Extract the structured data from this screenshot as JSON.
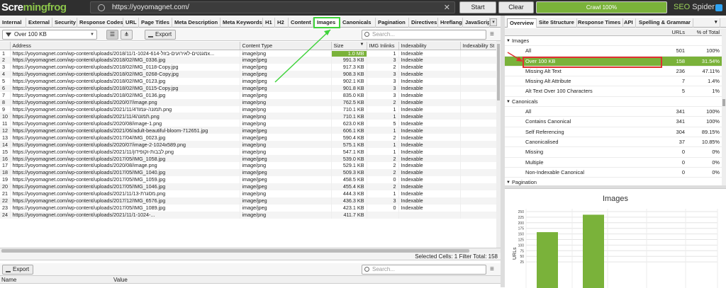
{
  "app": {
    "logo_main": "Scre",
    "logo_accent": "mingfrog",
    "url": "https://yoyomagnet.com/",
    "start_label": "Start",
    "clear_label": "Clear",
    "crawl_label": "Crawl 100%",
    "brand_seo": "SEO",
    "brand_spider": " Spider"
  },
  "tabs": [
    "Internal",
    "External",
    "Security",
    "Response Codes",
    "URL",
    "Page Titles",
    "Meta Description",
    "Meta Keywords",
    "H1",
    "H2",
    "Content",
    "Images",
    "Canonicals",
    "Pagination",
    "Directives",
    "Hreflang",
    "JavaScript"
  ],
  "toolbar": {
    "filter_value": "Over 100 KB",
    "export_label": "Export",
    "search_placeholder": "Search..."
  },
  "table": {
    "columns": [
      "",
      "Address",
      "Content Type",
      "Size",
      "IMG Inlinks",
      "Indexability",
      "Indexability St"
    ],
    "rows": [
      [
        "1",
        "https://yoyomagnet.com/wp-content/uploads/2018/11/1-1024-מגנטים-לאירועים-בזול-614x...",
        "image/png",
        "1.0 MB",
        "1",
        "Indexable"
      ],
      [
        "2",
        "https://yoyomagnet.com/wp-content/uploads/2018/02/IMG_0336.jpg",
        "image/jpeg",
        "991.3 KB",
        "3",
        "Indexable"
      ],
      [
        "3",
        "https://yoyomagnet.com/wp-content/uploads/2018/02/IMG_0118-Copy.jpg",
        "image/jpeg",
        "917.3 KB",
        "2",
        "Indexable"
      ],
      [
        "4",
        "https://yoyomagnet.com/wp-content/uploads/2018/02/IMG_0268-Copy.jpg",
        "image/jpeg",
        "908.3 KB",
        "3",
        "Indexable"
      ],
      [
        "5",
        "https://yoyomagnet.com/wp-content/uploads/2018/02/IMG_0123.jpg",
        "image/jpeg",
        "902.1 KB",
        "3",
        "Indexable"
      ],
      [
        "6",
        "https://yoyomagnet.com/wp-content/uploads/2018/02/IMG_0115-Copy.jpg",
        "image/jpeg",
        "901.8 KB",
        "3",
        "Indexable"
      ],
      [
        "7",
        "https://yoyomagnet.com/wp-content/uploads/2018/02/IMG_0136.jpg",
        "image/jpeg",
        "835.0 KB",
        "3",
        "Indexable"
      ],
      [
        "8",
        "https://yoyomagnet.com/wp-content/uploads/2020/07/image.png",
        "image/png",
        "762.5 KB",
        "2",
        "Indexable"
      ],
      [
        "9",
        "https://yoyomagnet.com/wp-content/uploads/2021/11/תמונה-עמוד4.png",
        "image/png",
        "710.1 KB",
        "1",
        "Indexable"
      ],
      [
        "10",
        "https://yoyomagnet.com/wp-content/uploads/2021/11/תמונה4.png",
        "image/png",
        "710.1 KB",
        "1",
        "Indexable"
      ],
      [
        "11",
        "https://yoyomagnet.com/wp-content/uploads/2020/08/image-1.png",
        "image/png",
        "623.0 KB",
        "5",
        "Indexable"
      ],
      [
        "12",
        "https://yoyomagnet.com/wp-content/uploads/2021/06/adult-beautiful-bloom-712651.jpg",
        "image/jpeg",
        "606.1 KB",
        "1",
        "Indexable"
      ],
      [
        "13",
        "https://yoyomagnet.com/wp-content/uploads/2017/04/IMG_0023.jpg",
        "image/jpeg",
        "590.4 KB",
        "2",
        "Indexable"
      ],
      [
        "14",
        "https://yoyomagnet.com/wp-content/uploads/2020/07/image-2-1024x589.png",
        "image/png",
        "575.1 KB",
        "1",
        "Indexable"
      ],
      [
        "15",
        "https://yoyomagnet.com/wp-content/uploads/2021/11/לבבות-וקופידון.png",
        "image/png",
        "547.1 KB",
        "1",
        "Indexable"
      ],
      [
        "16",
        "https://yoyomagnet.com/wp-content/uploads/2017/05/IMG_1058.jpg",
        "image/jpeg",
        "539.0 KB",
        "2",
        "Indexable"
      ],
      [
        "17",
        "https://yoyomagnet.com/wp-content/uploads/2020/08/image.png",
        "image/png",
        "529.1 KB",
        "2",
        "Indexable"
      ],
      [
        "18",
        "https://yoyomagnet.com/wp-content/uploads/2017/05/IMG_1040.jpg",
        "image/jpeg",
        "509.3 KB",
        "2",
        "Indexable"
      ],
      [
        "19",
        "https://yoyomagnet.com/wp-content/uploads/2017/05/IMG_1059.jpg",
        "image/jpeg",
        "458.5 KB",
        "0",
        "Indexable"
      ],
      [
        "20",
        "https://yoyomagnet.com/wp-content/uploads/2017/05/IMG_1046.jpg",
        "image/jpeg",
        "455.4 KB",
        "2",
        "Indexable"
      ],
      [
        "21",
        "https://yoyomagnet.com/wp-content/uploads/2021/11/13-מסגרת.png",
        "image/png",
        "444.3 KB",
        "1",
        "Indexable"
      ],
      [
        "22",
        "https://yoyomagnet.com/wp-content/uploads/2017/12/IMG_6576.jpg",
        "image/jpeg",
        "436.3 KB",
        "3",
        "Indexable"
      ],
      [
        "23",
        "https://yoyomagnet.com/wp-content/uploads/2017/05/IMG_1089.jpg",
        "image/jpeg",
        "423.1 KB",
        "0",
        "Indexable"
      ],
      [
        "24",
        "https://yoyomagnet.com/wp-content/uploads/2021/11/1-1024-...",
        "image/png",
        "411.7 KB",
        "",
        ""
      ]
    ]
  },
  "status": {
    "text": "Selected Cells:  1  Filter Total:  158"
  },
  "lower": {
    "export_label": "Export",
    "search_placeholder": "Search...",
    "col_name": "Name",
    "col_value": "Value"
  },
  "right_tabs": [
    "Overview",
    "Site Structure",
    "Response Times",
    "API",
    "Spelling & Grammar"
  ],
  "overview": {
    "col_urls": "URLs",
    "col_pct": "% of Total",
    "rows": [
      {
        "label": "Images",
        "urls": "",
        "pct": "",
        "cat": true
      },
      {
        "label": "All",
        "urls": "501",
        "pct": "100%"
      },
      {
        "label": "Over 100 KB",
        "urls": "158",
        "pct": "31.54%",
        "sel": true
      },
      {
        "label": "Missing Alt Text",
        "urls": "236",
        "pct": "47.11%"
      },
      {
        "label": "Missing Alt Attribute",
        "urls": "7",
        "pct": "1.4%"
      },
      {
        "label": "Alt Text Over 100 Characters",
        "urls": "5",
        "pct": "1%"
      },
      {
        "label": "Canonicals",
        "urls": "",
        "pct": "",
        "cat": true
      },
      {
        "label": "All",
        "urls": "341",
        "pct": "100%"
      },
      {
        "label": "Contains Canonical",
        "urls": "341",
        "pct": "100%"
      },
      {
        "label": "Self Referencing",
        "urls": "304",
        "pct": "89.15%"
      },
      {
        "label": "Canonicalised",
        "urls": "37",
        "pct": "10.85%"
      },
      {
        "label": "Missing",
        "urls": "0",
        "pct": "0%"
      },
      {
        "label": "Multiple",
        "urls": "0",
        "pct": "0%"
      },
      {
        "label": "Non-Indexable Canonical",
        "urls": "0",
        "pct": "0%"
      },
      {
        "label": "Pagination",
        "urls": "",
        "pct": "",
        "cat": true
      }
    ]
  },
  "chart_data": {
    "type": "bar",
    "title": "Images",
    "ylabel": "URLs",
    "y_ticks": [
      "250",
      "225",
      "200",
      "175",
      "150",
      "125",
      "100",
      "75",
      "50",
      "25"
    ],
    "ylim": [
      0,
      250
    ],
    "values": [
      158,
      236
    ],
    "bar_color": "#7ab23a"
  },
  "colors": {
    "accent": "#7ab23a",
    "highlight": "#3fd33b",
    "annotation_red": "#e03030"
  }
}
